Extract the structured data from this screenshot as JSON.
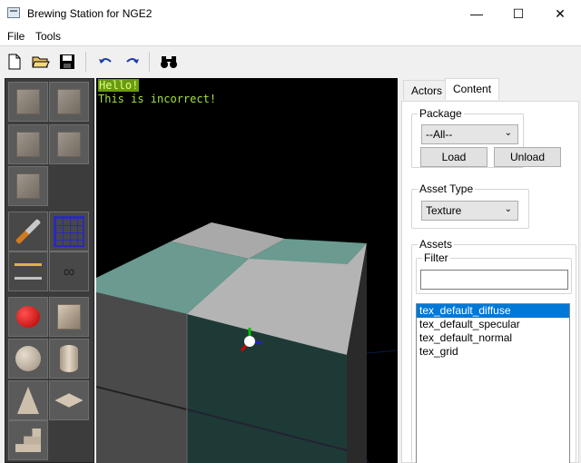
{
  "window": {
    "title": "Brewing Station for NGE2",
    "minimize": "—",
    "maximize": "☐",
    "close": "✕"
  },
  "menu": {
    "file": "File",
    "tools": "Tools"
  },
  "toolbar": {
    "new_icon": "new-document-icon",
    "open_icon": "open-folder-icon",
    "save_icon": "save-disk-icon",
    "undo_icon": "undo-icon",
    "redo_icon": "redo-icon",
    "find_icon": "binoculars-icon"
  },
  "viewport": {
    "line1": "Hello!",
    "line2": "This is incorrect!"
  },
  "tabs": {
    "actors": "Actors",
    "content": "Content"
  },
  "package": {
    "legend": "Package",
    "selected": "--All--",
    "load": "Load",
    "unload": "Unload"
  },
  "asset_type": {
    "legend": "Asset Type",
    "selected": "Texture"
  },
  "assets": {
    "legend": "Assets",
    "filter_legend": "Filter",
    "filter_value": "",
    "items": [
      "tex_default_diffuse",
      "tex_default_specular",
      "tex_default_normal",
      "tex_grid"
    ],
    "selected_index": 0
  },
  "colors": {
    "selection": "#0078d7",
    "viewport_text": "#a0e040",
    "viewport_text_bg": "#6a9a10"
  }
}
